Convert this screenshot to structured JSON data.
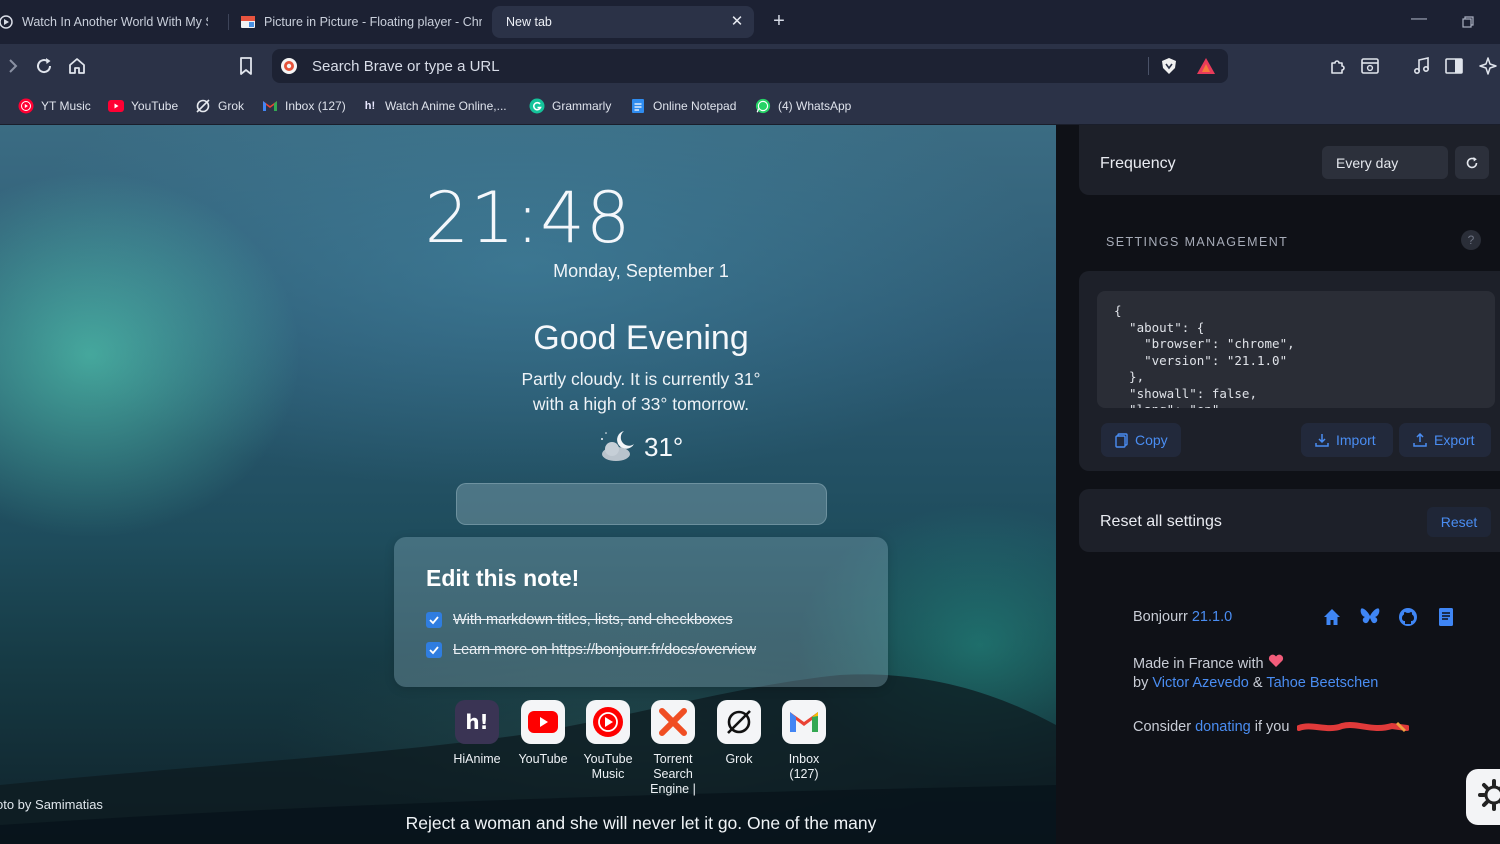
{
  "tabs": [
    {
      "title": "Watch In Another World With My Sm",
      "active": false
    },
    {
      "title": "Picture in Picture - Floating player - Chrome",
      "active": false
    },
    {
      "title": "New tab",
      "active": true
    }
  ],
  "toolbar": {
    "url_placeholder": "Search Brave or type a URL"
  },
  "bookmarks": [
    {
      "label": "YT Music",
      "icon": "yt-music-icon"
    },
    {
      "label": "YouTube",
      "icon": "youtube-icon"
    },
    {
      "label": "Grok",
      "icon": "grok-icon"
    },
    {
      "label": "Inbox (127)",
      "icon": "gmail-icon"
    },
    {
      "label": "Watch Anime Online,...",
      "icon": "hianime-icon"
    },
    {
      "label": "Grammarly",
      "icon": "grammarly-icon"
    },
    {
      "label": "Online Notepad",
      "icon": "notepad-icon"
    },
    {
      "label": "(4) WhatsApp",
      "icon": "whatsapp-icon"
    }
  ],
  "newtab": {
    "time": "21:48",
    "date": "Monday, September 1",
    "greeting": "Good Evening",
    "weather_line1": "Partly cloudy. It is currently 31°",
    "weather_line2": "with a high of 33° tomorrow.",
    "temperature": "31°",
    "weather_icon": "partly-cloudy-night-icon",
    "note": {
      "title": "Edit this note!",
      "items": [
        {
          "text": "With markdown titles, lists, and checkboxes",
          "checked": true
        },
        {
          "text": "Learn more on https://bonjourr.fr/docs/overview",
          "checked": true
        }
      ]
    },
    "quick_links": [
      {
        "label": "HiAnime",
        "icon": "hianime-icon"
      },
      {
        "label": "YouTube",
        "icon": "youtube-icon"
      },
      {
        "label": "YouTube Music",
        "icon": "yt-music-icon"
      },
      {
        "label": "Torrent Search Engine |",
        "icon": "torrent-icon"
      },
      {
        "label": "Grok",
        "icon": "grok-icon"
      },
      {
        "label": "Inbox (127)",
        "icon": "gmail-icon"
      }
    ],
    "photo_credit": "oto by Samimatias",
    "quote_line1": "Reject a woman and she will never let it go. One of the many"
  },
  "settings": {
    "frequency_label": "Frequency",
    "frequency_value": "Every day",
    "section_title": "SETTINGS MANAGEMENT",
    "help": "?",
    "json_text": "{\n  \"about\": {\n    \"browser\": \"chrome\",\n    \"version\": \"21.1.0\"\n  },\n  \"showall\": false,\n  \"lang\": \"en\",",
    "copy_label": "Copy",
    "import_label": "Import",
    "export_label": "Export",
    "reset_label": "Reset all settings",
    "reset_button": "Reset",
    "about": {
      "app_name": "Bonjourr",
      "version": "21.1.0",
      "made_in": "Made in France with",
      "by": "by",
      "author1": "Victor Azevedo",
      "and": "&",
      "author2": "Tahoe Beetschen",
      "consider": "Consider",
      "donating": "donating",
      "if_you": "if you"
    }
  },
  "colors": {
    "accent": "#4a8df2",
    "panel_bg": "#0f1117",
    "card_bg": "#1d2029",
    "chrome_bg": "#2b3247"
  }
}
